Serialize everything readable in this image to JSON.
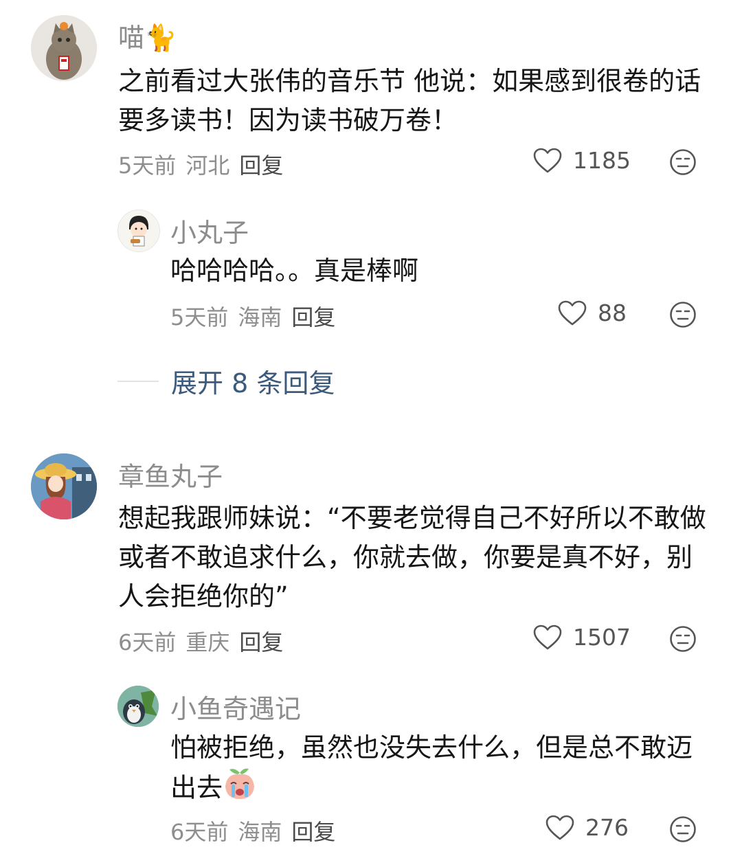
{
  "comments": [
    {
      "name": "喵🐈",
      "text": "之前看过大张伟的音乐节 他说：如果感到很卷的话 要多读书！因为读书破万卷！",
      "time": "5天前",
      "location": "河北",
      "reply": "回复",
      "likes": "1185",
      "replies": [
        {
          "name": "小丸子",
          "text": "哈哈哈哈。。真是棒啊",
          "time": "5天前",
          "location": "海南",
          "reply": "回复",
          "likes": "88"
        }
      ],
      "expand_label": "展开 8 条回复"
    },
    {
      "name": "章鱼丸子",
      "text": "想起我跟师妹说：“不要老觉得自己不好所以不敢做或者不敢追求什么，你就去做，你要是真不好，别人会拒绝你的”",
      "time": "6天前",
      "location": "重庆",
      "reply": "回复",
      "likes": "1507",
      "replies": [
        {
          "name": "小鱼奇遇记",
          "text": "怕被拒绝，虽然也没失去什么，但是总不敢迈出去",
          "time": "6天前",
          "location": "海南",
          "reply": "回复",
          "likes": "276"
        }
      ]
    }
  ],
  "icons": {
    "like": "heart-outline-icon",
    "dislike": "unamused-face-icon",
    "sticker": "crying-peach-sticker"
  },
  "colors": {
    "name": "#8c8c8c",
    "meta": "#8e8e8e",
    "expand": "#3b5a7c"
  }
}
